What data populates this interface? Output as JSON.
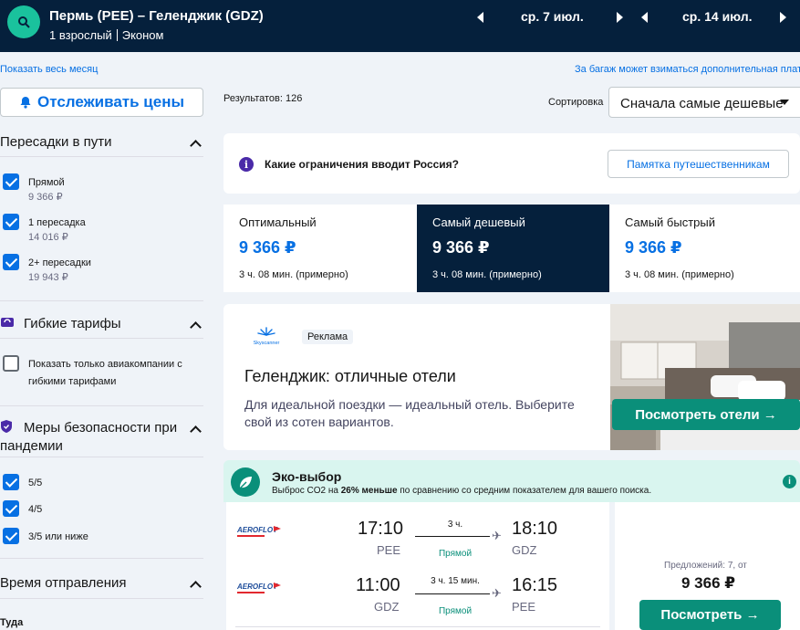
{
  "header": {
    "route": "Пермь (PEE) – Геленджик (GDZ)",
    "passengers": "1 взрослый",
    "cabin": "Эконом",
    "depart_date": "ср. 7 июл.",
    "return_date": "ср. 14 июл."
  },
  "links": {
    "show_month": "Показать весь месяц",
    "baggage_note": "За багаж может взиматься дополнительная плата"
  },
  "sidebar": {
    "track_prices": "Отслеживать цены",
    "stops": {
      "title": "Пересадки в пути",
      "items": [
        {
          "label": "Прямой",
          "price": "9 366 ₽",
          "checked": true
        },
        {
          "label": "1 пересадка",
          "price": "14 016 ₽",
          "checked": true
        },
        {
          "label": "2+ пересадки",
          "price": "19 943 ₽",
          "checked": true
        }
      ]
    },
    "flex": {
      "title": "Гибкие тарифы",
      "option_line1": "Показать только авиакомпании с",
      "option_line2": "гибкими тарифами"
    },
    "safety": {
      "title_line1": "Меры безопасности при",
      "title_line2": "пандемии",
      "items": [
        {
          "label": "5/5",
          "checked": true
        },
        {
          "label": "4/5",
          "checked": true
        },
        {
          "label": "3/5 или ниже",
          "checked": true
        }
      ]
    },
    "departure": {
      "title": "Время отправления",
      "sub": "Туда"
    }
  },
  "main": {
    "results": "Результатов: 126",
    "sort_label": "Сортировка",
    "sort_value": "Сначала самые дешевые",
    "russia_question": "Какие ограничения вводит Россия?",
    "traveler_memo": "Памятка путешественникам",
    "tabs": [
      {
        "name": "Оптимальный",
        "price": "9 366 ₽",
        "duration": "3 ч. 08 мин. (примерно)"
      },
      {
        "name": "Самый дешевый",
        "price": "9 366 ₽",
        "duration": "3 ч. 08 мин. (примерно)"
      },
      {
        "name": "Самый быстрый",
        "price": "9 366 ₽",
        "duration": "3 ч. 08 мин. (примерно)"
      }
    ],
    "ad": {
      "brand": "Skyscanner",
      "badge": "Реклама",
      "title": "Геленджик: отличные отели",
      "text_line1": "Для идеальной поездки — идеальный отель. Выберите",
      "text_line2": "свой из сотен вариантов.",
      "button": "Посмотреть отели →"
    },
    "eco": {
      "title": "Эко-выбор",
      "sub_pre": "Выброс CO2 на ",
      "sub_bold": "26% меньше",
      "sub_post": " по сравнению со средним показателем для вашего поиска."
    },
    "flight": {
      "legs": [
        {
          "airline": "AEROFLOT",
          "dep_time": "17:10",
          "dep_airport": "PEE",
          "duration": "3 ч.",
          "stops": "Прямой",
          "arr_time": "18:10",
          "arr_airport": "GDZ"
        },
        {
          "airline": "AEROFLOT",
          "dep_time": "11:00",
          "dep_airport": "GDZ",
          "duration": "3 ч. 15 мин.",
          "stops": "Прямой",
          "arr_time": "16:15",
          "arr_airport": "PEE"
        }
      ],
      "offers": "Предложений: 7, от",
      "price": "9 366 ₽",
      "button": "Посмотреть →"
    }
  }
}
